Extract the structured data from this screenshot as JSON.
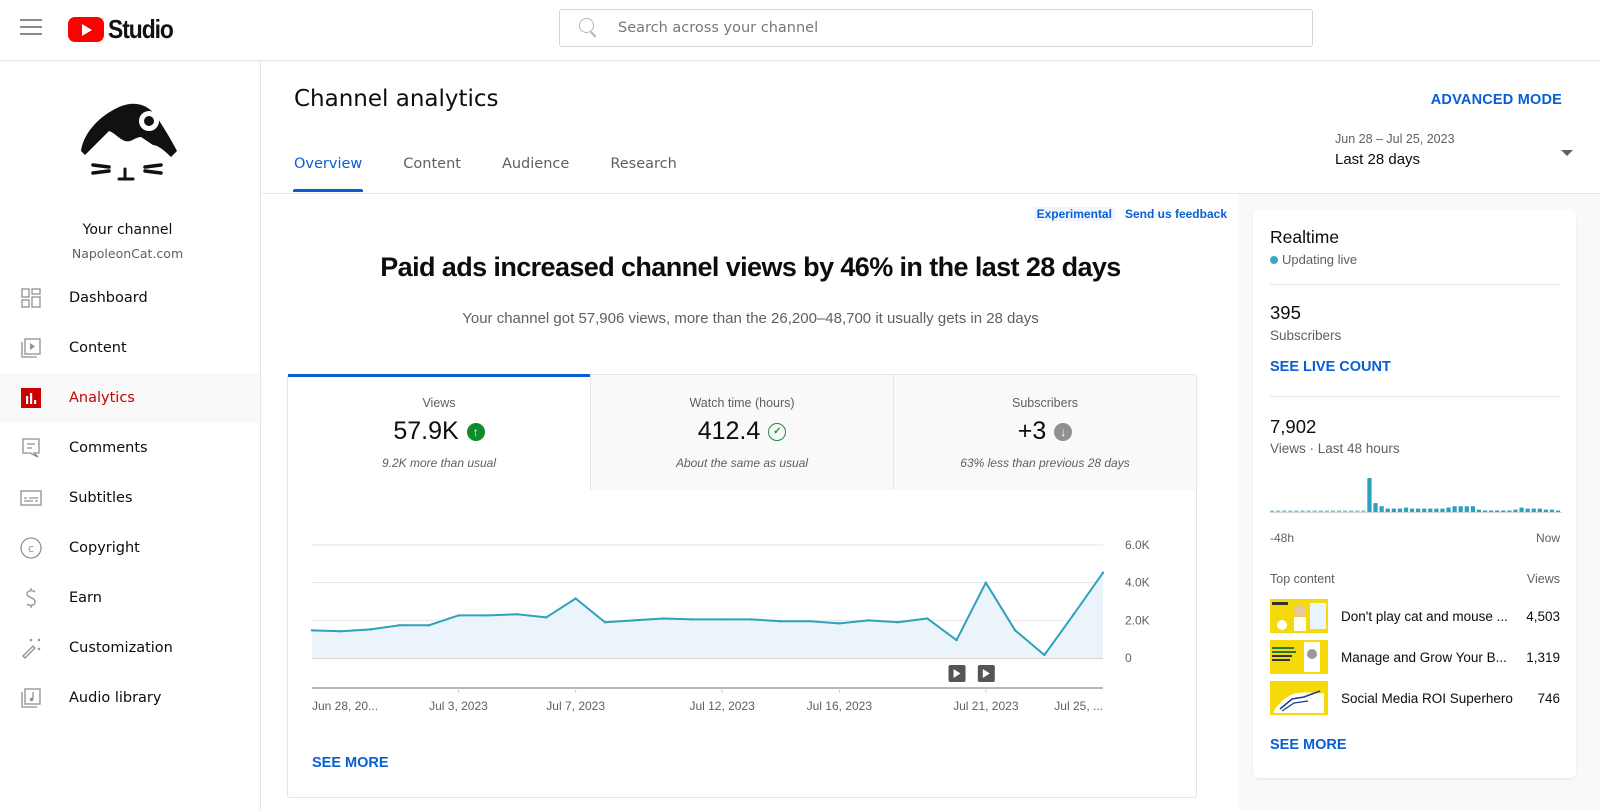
{
  "app": {
    "logo_text": "Studio",
    "search_placeholder": "Search across your channel"
  },
  "channel": {
    "name": "Your channel",
    "handle": "NapoleonCat.com"
  },
  "sidebar": {
    "items": [
      {
        "label": "Dashboard",
        "icon": "dashboard-icon",
        "active": false
      },
      {
        "label": "Content",
        "icon": "content-icon",
        "active": false
      },
      {
        "label": "Analytics",
        "icon": "analytics-icon",
        "active": true
      },
      {
        "label": "Comments",
        "icon": "comments-icon",
        "active": false
      },
      {
        "label": "Subtitles",
        "icon": "subtitles-icon",
        "active": false
      },
      {
        "label": "Copyright",
        "icon": "copyright-icon",
        "active": false
      },
      {
        "label": "Earn",
        "icon": "earn-icon",
        "active": false
      },
      {
        "label": "Customization",
        "icon": "customization-icon",
        "active": false
      },
      {
        "label": "Audio library",
        "icon": "audio-library-icon",
        "active": false
      }
    ]
  },
  "header": {
    "title": "Channel analytics",
    "advanced_mode": "ADVANCED MODE",
    "tabs": [
      "Overview",
      "Content",
      "Audience",
      "Research"
    ],
    "active_tab": "Overview",
    "date_range_sub": "Jun 28 – Jul 25, 2023",
    "date_range_main": "Last 28 days"
  },
  "overview": {
    "experimental_label": "Experimental",
    "feedback_label": "Send us feedback",
    "headline": "Paid ads increased channel views by 46% in the last 28 days",
    "subline": "Your channel got 57,906 views, more than the 26,200–48,700 it usually gets in 28 days",
    "metrics": [
      {
        "label": "Views",
        "value": "57.9K",
        "note": "9.2K more than usual",
        "status": "up",
        "status_color": "#0f8a2c"
      },
      {
        "label": "Watch time (hours)",
        "value": "412.4",
        "note": "About the same as usual",
        "status": "same",
        "status_color": "#1e8e3e"
      },
      {
        "label": "Subscribers",
        "value": "+3",
        "note": "63% less than previous 28 days",
        "status": "down",
        "status_color": "#909090"
      }
    ],
    "see_more": "SEE MORE"
  },
  "chart_data": {
    "type": "area",
    "title": "Views",
    "xlabel": "",
    "ylabel": "",
    "x": [
      "Jun 28",
      "Jun 29",
      "Jun 30",
      "Jul 1",
      "Jul 2",
      "Jul 3",
      "Jul 4",
      "Jul 5",
      "Jul 6",
      "Jul 7",
      "Jul 8",
      "Jul 9",
      "Jul 10",
      "Jul 11",
      "Jul 12",
      "Jul 13",
      "Jul 14",
      "Jul 15",
      "Jul 16",
      "Jul 17",
      "Jul 18",
      "Jul 19",
      "Jul 20",
      "Jul 21",
      "Jul 22",
      "Jul 23",
      "Jul 24",
      "Jul 25"
    ],
    "series": [
      {
        "name": "Views",
        "color": "#2ea2bd",
        "values": [
          1470,
          1420,
          1520,
          1740,
          1740,
          2260,
          2260,
          2320,
          2160,
          3160,
          1900,
          2000,
          2100,
          2050,
          2050,
          2050,
          1950,
          1950,
          1840,
          2000,
          1900,
          2100,
          950,
          4000,
          1470,
          160,
          2320,
          4530
        ]
      }
    ],
    "ylim": [
      0,
      6000
    ],
    "y_ticks": [
      {
        "value": 0,
        "label": "0"
      },
      {
        "value": 2000,
        "label": "2.0K"
      },
      {
        "value": 4000,
        "label": "4.0K"
      },
      {
        "value": 6000,
        "label": "6.0K"
      }
    ],
    "x_tick_labels": [
      {
        "index": 0,
        "label": "Jun 28, 20..."
      },
      {
        "index": 5,
        "label": "Jul 3, 2023"
      },
      {
        "index": 9,
        "label": "Jul 7, 2023"
      },
      {
        "index": 14,
        "label": "Jul 12, 2023"
      },
      {
        "index": 18,
        "label": "Jul 16, 2023"
      },
      {
        "index": 23,
        "label": "Jul 21, 2023"
      },
      {
        "index": 27,
        "label": "Jul 25, ..."
      }
    ],
    "video_markers": [
      22,
      23
    ],
    "grid": true,
    "legend": "none"
  },
  "realtime": {
    "title": "Realtime",
    "status": "Updating live",
    "subscribers_value": "395",
    "subscribers_label": "Subscribers",
    "see_live_count": "SEE LIVE COUNT",
    "views_value": "7,902",
    "views_label": "Views · Last 48 hours",
    "axis_start": "-48h",
    "axis_end": "Now",
    "bars_relative": [
      0,
      0,
      0,
      0,
      0,
      0,
      0,
      0,
      0,
      0,
      0,
      0,
      0,
      0,
      0,
      0,
      1.0,
      0.26,
      0.17,
      0.1,
      0.1,
      0.1,
      0.13,
      0.1,
      0.1,
      0.1,
      0.1,
      0.1,
      0.1,
      0.13,
      0.17,
      0.17,
      0.17,
      0.17,
      0.07,
      0.03,
      0.03,
      0.03,
      0.03,
      0.03,
      0.07,
      0.13,
      0.1,
      0.1,
      0.1,
      0.07,
      0.07,
      0.03
    ],
    "top_content_label": "Top content",
    "views_col_label": "Views",
    "top_content": [
      {
        "title": "Don't play cat and mouse ...",
        "views": "4,503"
      },
      {
        "title": "Manage and Grow Your B...",
        "views": "1,319"
      },
      {
        "title": "Social Media ROI Superhero",
        "views": "746"
      }
    ],
    "see_more": "SEE MORE"
  }
}
